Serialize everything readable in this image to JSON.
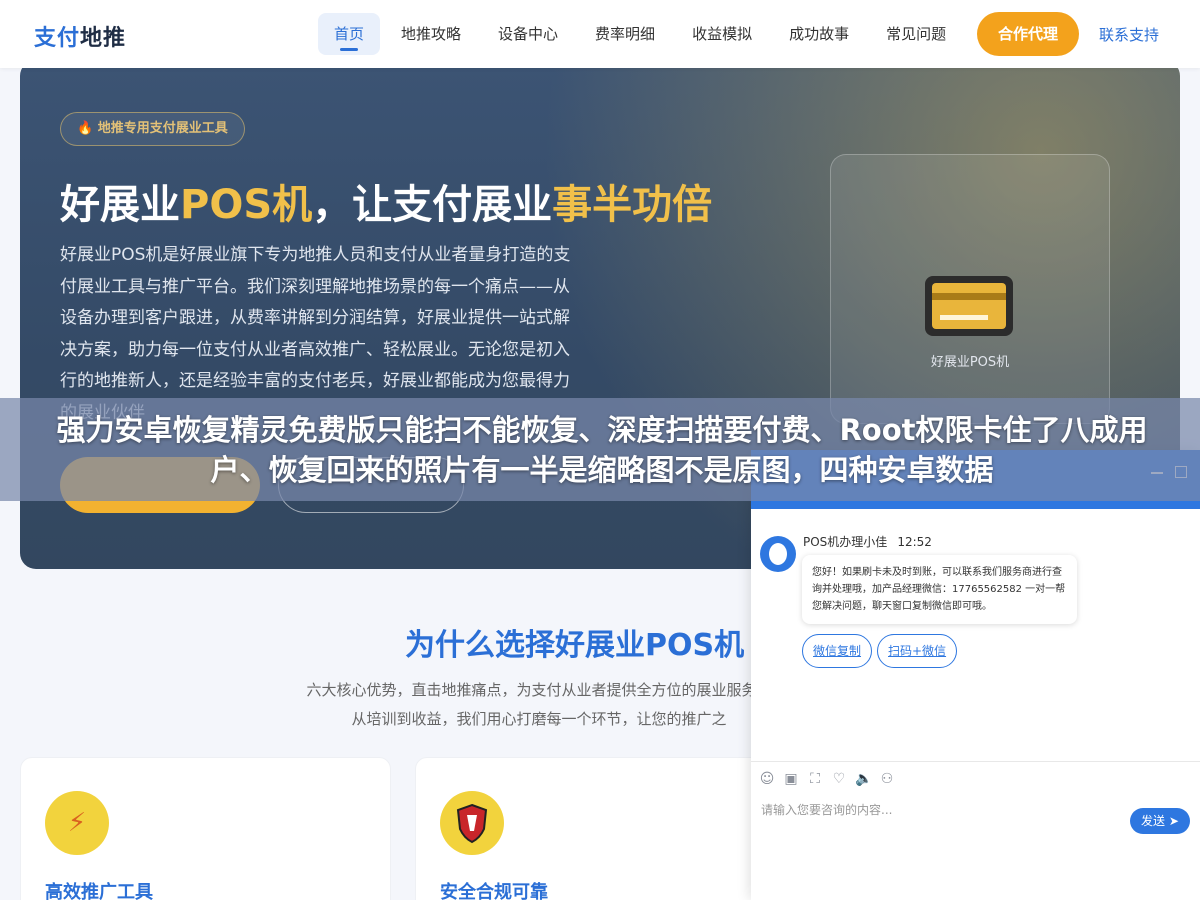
{
  "header": {
    "logo_part1": "支付",
    "logo_part2": "地推",
    "nav": [
      "首页",
      "地推攻略",
      "设备中心",
      "费率明细",
      "收益模拟",
      "成功故事",
      "常见问题"
    ],
    "cta_label": "合作代理",
    "contact_label": "联系支持"
  },
  "hero": {
    "tag": "🔥 地推专用支付展业工具",
    "title_part1": "好展业",
    "title_part2": "POS机",
    "title_part3": "，让支付展业",
    "title_part4": "事半功倍",
    "description": "好展业POS机是好展业旗下专为地推人员和支付从业者量身打造的支付展业工具与推广平台。我们深刻理解地推场景的每一个痛点——从设备办理到客户跟进，从费率讲解到分润结算，好展业提供一站式解决方案，助力每一位支付从业者高效推广、轻松展业。无论您是初入行的地推新人，还是经验丰富的支付老兵，好展业都能成为您最得力的展业伙伴",
    "device_label": "好展业POS机"
  },
  "overlay": {
    "text": "强力安卓恢复精灵免费版只能扫不能恢复、深度扫描要付费、Root权限卡住了八成用户、恢复回来的照片有一半是缩略图不是原图，四种安卓数据"
  },
  "section": {
    "title": "为什么选择好展业POS机",
    "description": "六大核心优势，直击地推痛点，为支付从业者提供全方位的展业服务，从培训到收益，我们用心打磨每一个环节，让您的推广之"
  },
  "features": [
    {
      "title": "高效推广工具",
      "icon": "lightning-icon"
    },
    {
      "title": "安全合规可靠",
      "icon": "shield-icon"
    }
  ],
  "chat": {
    "sender": "POS机办理小佳",
    "time": "12:52",
    "message": "您好！如果刷卡未及时到账，可以联系我们服务商进行查询并处理哦，加产品经理微信：17765562582 一对一帮您解决问题，聊天窗口复制微信即可哦。",
    "chips": [
      "微信复制",
      "扫码+微信"
    ],
    "input_placeholder": "请输入您要咨询的内容...",
    "send_label": "发送"
  },
  "colors": {
    "brand_blue": "#2b6fd6",
    "accent_orange": "#f3a21c",
    "hero_bg": "#3c5474",
    "gold": "#f1c04a"
  }
}
